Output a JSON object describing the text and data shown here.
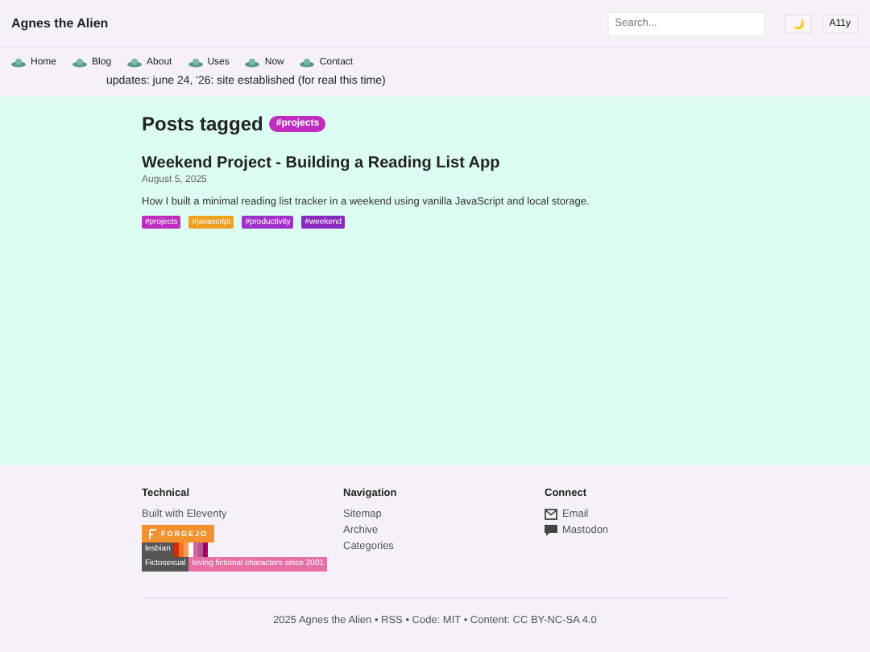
{
  "site_title": "Agnes the Alien",
  "search": {
    "placeholder": "Search..."
  },
  "theme_button": "🌙",
  "a11y_button": "A11y",
  "nav": [
    {
      "label": "Home"
    },
    {
      "label": "Blog"
    },
    {
      "label": "About"
    },
    {
      "label": "Uses"
    },
    {
      "label": "Now"
    },
    {
      "label": "Contact"
    }
  ],
  "updates": "updates: june 24, '26: site established (for real this time)",
  "heading": "Posts tagged",
  "heading_tag": "#projects",
  "posts": [
    {
      "title": "Weekend Project - Building a Reading List App",
      "date": "August 5, 2025",
      "summary": "How I built a minimal reading list tracker in a weekend using vanilla JavaScript and local storage.",
      "tags": [
        {
          "label": "#projects",
          "color": "#c02cc0"
        },
        {
          "label": "#javascript",
          "color": "#f0a020"
        },
        {
          "label": "#productivity",
          "color": "#a030c8"
        },
        {
          "label": "#weekend",
          "color": "#8a28c0"
        }
      ]
    }
  ],
  "footer": {
    "columns": [
      {
        "heading": "Technical",
        "links": [
          {
            "label": "Built with Eleventy"
          }
        ],
        "badges": [
          {
            "kind": "forgejo",
            "label": "FORGEJO"
          },
          {
            "kind": "flag",
            "label": "lesbian"
          },
          {
            "kind": "text",
            "label": "Fictosexual",
            "value": "loving fictional characters since 2001"
          }
        ]
      },
      {
        "heading": "Navigation",
        "links": [
          {
            "label": "Sitemap"
          },
          {
            "label": "Archive"
          },
          {
            "label": "Categories"
          }
        ]
      },
      {
        "heading": "Connect",
        "links": [
          {
            "label": "Email",
            "kind": "mail"
          },
          {
            "label": "Mastodon",
            "kind": "chat"
          }
        ]
      }
    ],
    "copyright": "2025 Agnes the Alien • RSS • Code: MIT • Content: CC BY-NC-SA 4.0"
  }
}
